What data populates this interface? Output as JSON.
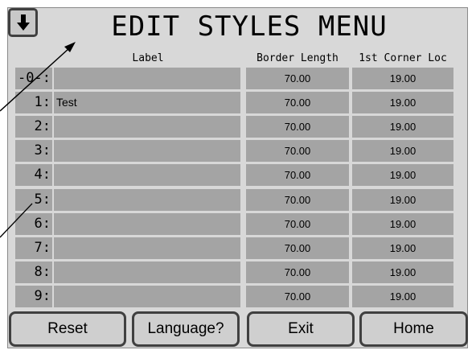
{
  "title": "EDIT STYLES MENU",
  "back_icon": "down-arrow-icon",
  "columns": {
    "label": "Label",
    "border_length": "Border Length",
    "corner_loc": "1st Corner Loc"
  },
  "rows": [
    {
      "num": "-0-:",
      "label": "",
      "border_length": "70.00",
      "corner_loc": "19.00"
    },
    {
      "num": "1:",
      "label": "Test",
      "border_length": "70.00",
      "corner_loc": "19.00"
    },
    {
      "num": "2:",
      "label": "",
      "border_length": "70.00",
      "corner_loc": "19.00"
    },
    {
      "num": "3:",
      "label": "",
      "border_length": "70.00",
      "corner_loc": "19.00"
    },
    {
      "num": "4:",
      "label": "",
      "border_length": "70.00",
      "corner_loc": "19.00"
    },
    {
      "num": "5:",
      "label": "",
      "border_length": "70.00",
      "corner_loc": "19.00"
    },
    {
      "num": "6:",
      "label": "",
      "border_length": "70.00",
      "corner_loc": "19.00"
    },
    {
      "num": "7:",
      "label": "",
      "border_length": "70.00",
      "corner_loc": "19.00"
    },
    {
      "num": "8:",
      "label": "",
      "border_length": "70.00",
      "corner_loc": "19.00"
    },
    {
      "num": "9:",
      "label": "",
      "border_length": "70.00",
      "corner_loc": "19.00"
    }
  ],
  "buttons": {
    "reset": "Reset",
    "language": "Language?",
    "exit": "Exit",
    "home": "Home"
  },
  "colors": {
    "panel": "#d8d8d8",
    "cell": "#a4a4a4",
    "button_border": "#404040"
  }
}
